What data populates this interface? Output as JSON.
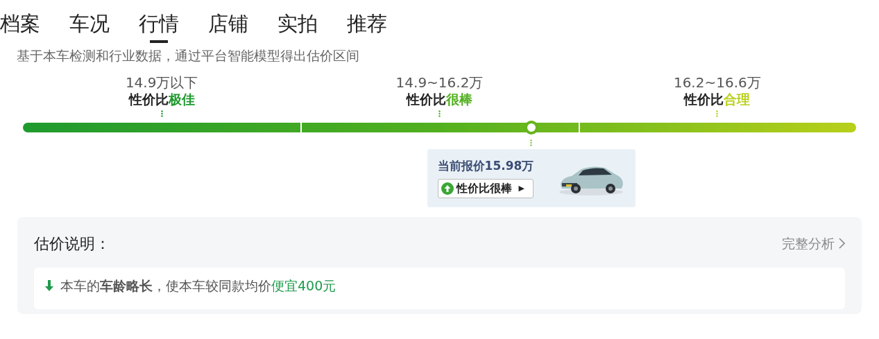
{
  "tabs": [
    {
      "label": "档案",
      "selected": false
    },
    {
      "label": "车况",
      "selected": false
    },
    {
      "label": "行情",
      "selected": true
    },
    {
      "label": "店铺",
      "selected": false
    },
    {
      "label": "实拍",
      "selected": false
    },
    {
      "label": "推荐",
      "selected": false
    }
  ],
  "subtitle": "基于本车检测和行业数据，通过平台智能模型得出估价区间",
  "ranges": [
    {
      "price": "14.9万以下",
      "prefix": "性价比",
      "rating": "极佳",
      "color": "#1f9a2e"
    },
    {
      "price": "14.9~16.2万",
      "prefix": "性价比",
      "rating": "很棒",
      "color": "#52b01f"
    },
    {
      "price": "16.2~16.6万",
      "prefix": "性价比",
      "rating": "合理",
      "color": "#b8d01a"
    }
  ],
  "marker": {
    "level": 0.61
  },
  "current": {
    "price": "当前报价15.98万",
    "rating": "性价比很棒",
    "arrow": "▶"
  },
  "explanation": {
    "title": "估价说明：",
    "link": "完整分析",
    "items": [
      {
        "text": "本车的**车龄略长**，使本车较同款均价",
        "highlight": "便宜400元",
        "kind": "decrease"
      }
    ]
  }
}
